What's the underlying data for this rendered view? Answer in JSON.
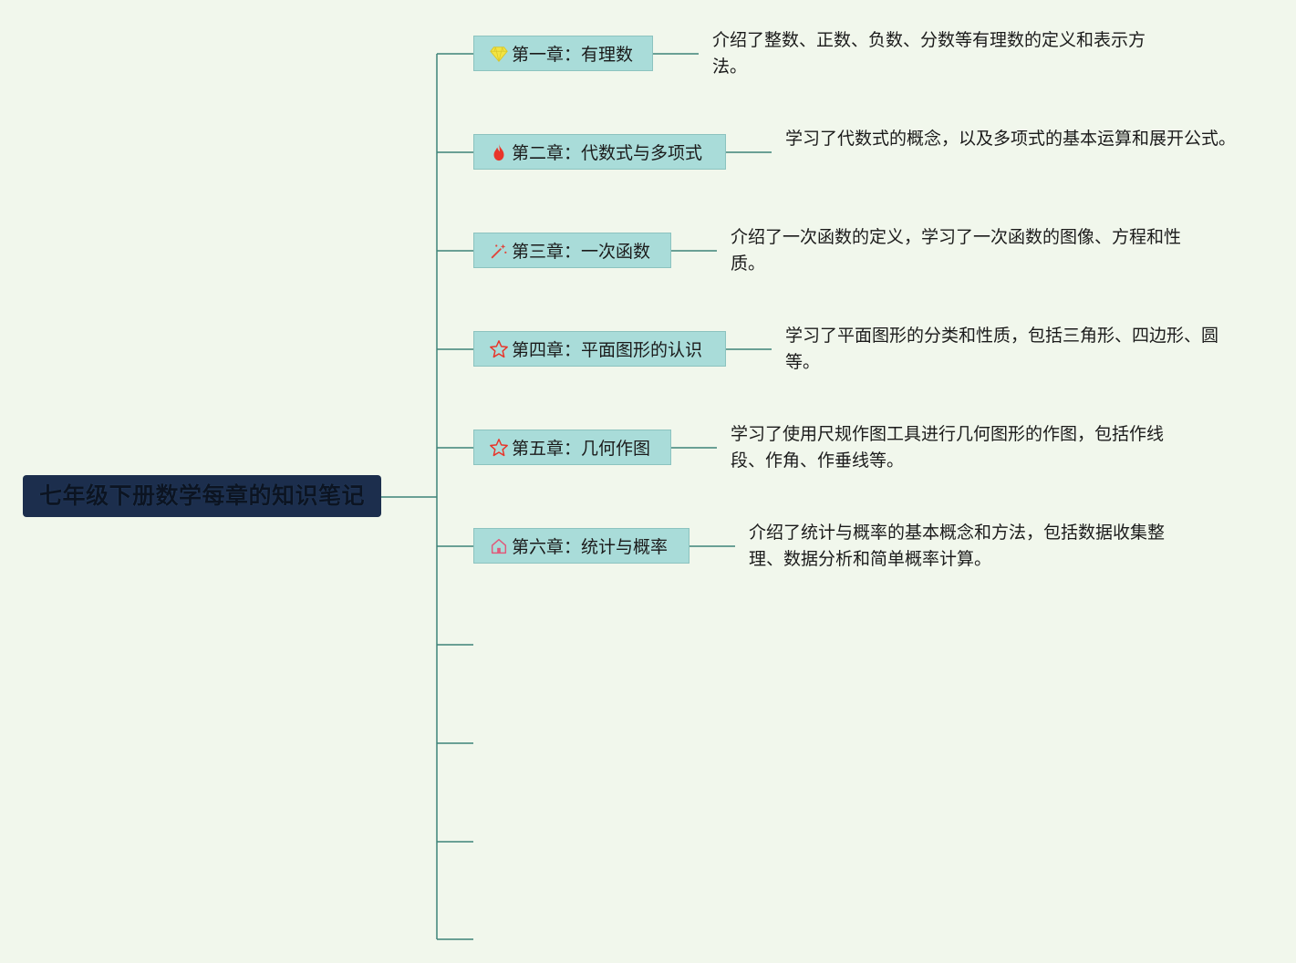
{
  "root": {
    "title": "七年级下册数学每章的知识笔记"
  },
  "chapters": [
    {
      "title": "第一章：有理数",
      "icon": "diamond-icon",
      "icon_color": "#f2e442",
      "note": "介绍了整数、正数、负数、分数等有理数的定义和表示方法。"
    },
    {
      "title": "第二章：代数式与多项式",
      "icon": "fire-icon",
      "icon_color": "#e8352a",
      "note": "学习了代数式的概念，以及多项式的基本运算和展开公式。"
    },
    {
      "title": "第三章：一次函数",
      "icon": "magic-wand-icon",
      "icon_color": "#e0463c",
      "note": "介绍了一次函数的定义，学习了一次函数的图像、方程和性质。"
    },
    {
      "title": "第四章：平面图形的认识",
      "icon": "star-icon",
      "icon_color": "#e8352a",
      "note": "学习了平面图形的分类和性质，包括三角形、四边形、圆等。"
    },
    {
      "title": "第五章：几何作图",
      "icon": "star-icon",
      "icon_color": "#e8352a",
      "note": "学习了使用尺规作图工具进行几何图形的作图，包括作线段、作角、作垂线等。"
    },
    {
      "title": "第六章：统计与概率",
      "icon": "home-icon",
      "icon_color": "#e05a7a",
      "note": "介绍了统计与概率的基本概念和方法，包括数据收集整理、数据分析和简单概率计算。"
    }
  ],
  "colors": {
    "background": "#f1f7ec",
    "connector": "#3d8478",
    "root_fill": "#1c2e4d",
    "chapter_fill": "#a9dcd9"
  }
}
